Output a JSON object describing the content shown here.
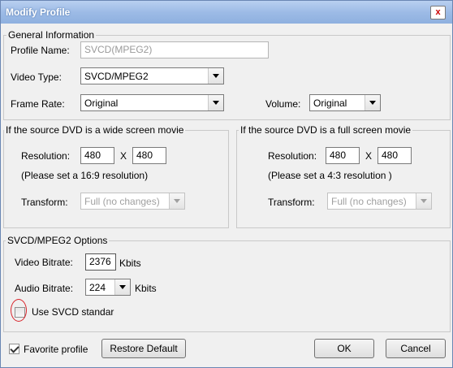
{
  "window": {
    "title": "Modify Profile",
    "close_glyph": "x"
  },
  "general": {
    "legend": "General Information",
    "profile_name_label": "Profile Name:",
    "profile_name_value": "SVCD(MPEG2)",
    "video_type_label": "Video Type:",
    "video_type_value": "SVCD/MPEG2",
    "frame_rate_label": "Frame Rate:",
    "frame_rate_value": "Original",
    "volume_label": "Volume:",
    "volume_value": "Original"
  },
  "wide": {
    "legend": "If the source DVD is a wide screen movie",
    "resolution_label": "Resolution:",
    "width": "480",
    "x": "X",
    "height": "480",
    "hint": "(Please set a 16:9 resolution)",
    "transform_label": "Transform:",
    "transform_value": "Full (no changes)"
  },
  "full": {
    "legend": "If the source DVD is a full screen movie",
    "resolution_label": "Resolution:",
    "width": "480",
    "x": "X",
    "height": "480",
    "hint": "(Please set a 4:3 resolution )",
    "transform_label": "Transform:",
    "transform_value": "Full (no changes)"
  },
  "svcd": {
    "legend": "SVCD/MPEG2 Options",
    "video_bitrate_label": "Video Bitrate:",
    "video_bitrate_value": "2376",
    "video_bitrate_unit": "Kbits",
    "audio_bitrate_label": "Audio Bitrate:",
    "audio_bitrate_value": "224",
    "audio_bitrate_unit": "Kbits",
    "use_standard_label": "Use SVCD standar",
    "use_standard_checked": false
  },
  "footer": {
    "favorite_label": "Favorite profile",
    "favorite_checked": true,
    "restore_label": "Restore Default",
    "ok_label": "OK",
    "cancel_label": "Cancel"
  },
  "colors": {
    "annotation": "#d8232a",
    "titlebar": "#9dbbe6"
  }
}
